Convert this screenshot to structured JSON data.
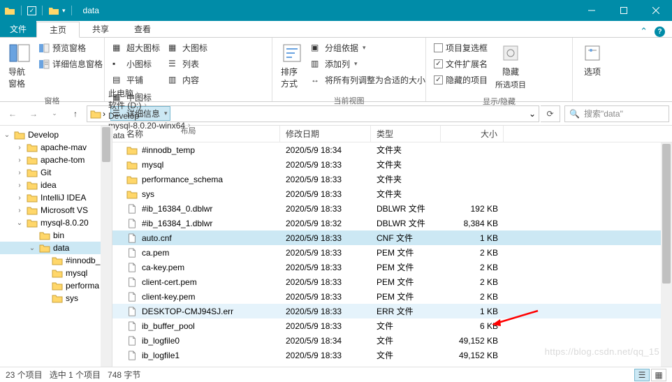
{
  "title": "data",
  "menu": {
    "file": "文件",
    "home": "主页",
    "share": "共享",
    "view": "查看"
  },
  "ribbon": {
    "panes_group": "窗格",
    "layout_group": "布局",
    "currentview_group": "当前视图",
    "showhide_group": "显示/隐藏",
    "nav_pane": "导航窗格",
    "preview_pane": "预览窗格",
    "details_pane": "详细信息窗格",
    "xl_icons": "超大图标",
    "l_icons": "大图标",
    "m_icons": "中图标",
    "s_icons": "小图标",
    "list": "列表",
    "details": "详细信息",
    "tiles": "平铺",
    "content": "内容",
    "sort": "排序方式",
    "group": "分组依据",
    "add_cols": "添加列",
    "fit_cols": "将所有列调整为合适的大小",
    "chk_boxes": "项目复选框",
    "ext": "文件扩展名",
    "hidden": "隐藏的项目",
    "hide": "隐藏",
    "hide2": "所选项目",
    "options": "选项"
  },
  "breadcrumbs": [
    "此电脑",
    "软件 (D:)",
    "Develop",
    "mysql-8.0.20-winx64",
    "data"
  ],
  "search_placeholder": "搜索\"data\"",
  "columns": {
    "name": "名称",
    "date": "修改日期",
    "type": "类型",
    "size": "大小"
  },
  "tree": [
    {
      "label": "Develop",
      "lvl": 0,
      "exp": "v"
    },
    {
      "label": "apache-mav",
      "lvl": 1,
      "exp": ">"
    },
    {
      "label": "apache-tom",
      "lvl": 1,
      "exp": ">"
    },
    {
      "label": "Git",
      "lvl": 1,
      "exp": ">"
    },
    {
      "label": "idea",
      "lvl": 1,
      "exp": ">"
    },
    {
      "label": "IntelliJ IDEA",
      "lvl": 1,
      "exp": ">"
    },
    {
      "label": "Microsoft VS",
      "lvl": 1,
      "exp": ">"
    },
    {
      "label": "mysql-8.0.20",
      "lvl": 1,
      "exp": "v"
    },
    {
      "label": "bin",
      "lvl": 2,
      "exp": ""
    },
    {
      "label": "data",
      "lvl": 2,
      "exp": "v",
      "sel": true
    },
    {
      "label": "#innodb_",
      "lvl": 3,
      "exp": ""
    },
    {
      "label": "mysql",
      "lvl": 3,
      "exp": ""
    },
    {
      "label": "performa",
      "lvl": 3,
      "exp": ""
    },
    {
      "label": "sys",
      "lvl": 3,
      "exp": ""
    }
  ],
  "files": [
    {
      "icon": "folder",
      "name": "#innodb_temp",
      "date": "2020/5/9 18:34",
      "type": "文件夹",
      "size": ""
    },
    {
      "icon": "folder",
      "name": "mysql",
      "date": "2020/5/9 18:33",
      "type": "文件夹",
      "size": ""
    },
    {
      "icon": "folder",
      "name": "performance_schema",
      "date": "2020/5/9 18:33",
      "type": "文件夹",
      "size": ""
    },
    {
      "icon": "folder",
      "name": "sys",
      "date": "2020/5/9 18:33",
      "type": "文件夹",
      "size": ""
    },
    {
      "icon": "file",
      "name": "#ib_16384_0.dblwr",
      "date": "2020/5/9 18:33",
      "type": "DBLWR 文件",
      "size": "192 KB"
    },
    {
      "icon": "file",
      "name": "#ib_16384_1.dblwr",
      "date": "2020/5/9 18:32",
      "type": "DBLWR 文件",
      "size": "8,384 KB"
    },
    {
      "icon": "file",
      "name": "auto.cnf",
      "date": "2020/5/9 18:33",
      "type": "CNF 文件",
      "size": "1 KB",
      "sel": true
    },
    {
      "icon": "file",
      "name": "ca.pem",
      "date": "2020/5/9 18:33",
      "type": "PEM 文件",
      "size": "2 KB"
    },
    {
      "icon": "file",
      "name": "ca-key.pem",
      "date": "2020/5/9 18:33",
      "type": "PEM 文件",
      "size": "2 KB"
    },
    {
      "icon": "file",
      "name": "client-cert.pem",
      "date": "2020/5/9 18:33",
      "type": "PEM 文件",
      "size": "2 KB"
    },
    {
      "icon": "file",
      "name": "client-key.pem",
      "date": "2020/5/9 18:33",
      "type": "PEM 文件",
      "size": "2 KB"
    },
    {
      "icon": "file",
      "name": "DESKTOP-CMJ94SJ.err",
      "date": "2020/5/9 18:33",
      "type": "ERR 文件",
      "size": "1 KB",
      "hl": true
    },
    {
      "icon": "file",
      "name": "ib_buffer_pool",
      "date": "2020/5/9 18:33",
      "type": "文件",
      "size": "6 KB"
    },
    {
      "icon": "file",
      "name": "ib_logfile0",
      "date": "2020/5/9 18:34",
      "type": "文件",
      "size": "49,152 KB"
    },
    {
      "icon": "file",
      "name": "ib_logfile1",
      "date": "2020/5/9 18:33",
      "type": "文件",
      "size": "49,152 KB"
    }
  ],
  "status": {
    "count": "23 个项目",
    "selected": "选中 1 个项目",
    "bytes": "748 字节"
  },
  "watermark": "https://blog.csdn.net/qq_15"
}
